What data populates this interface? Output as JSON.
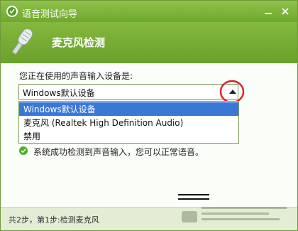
{
  "window": {
    "title": "语音测试向导"
  },
  "banner": {
    "title": "麦克风检测"
  },
  "content": {
    "device_label": "您正在使用的声音输入设备是:",
    "select": {
      "selected": "Windows默认设备",
      "options": [
        "Windows默认设备",
        "麦克风 (Realtek High Definition Audio)",
        "禁用"
      ]
    },
    "status": "系统成功检测到声音输入，您可以正常语音。"
  },
  "footer": {
    "step_text": "共2步，第1步:检测麦克风"
  },
  "colors": {
    "title_bar": "#7bb33b",
    "selection": "#3a78d6",
    "highlight_circle": "#d8252a"
  }
}
